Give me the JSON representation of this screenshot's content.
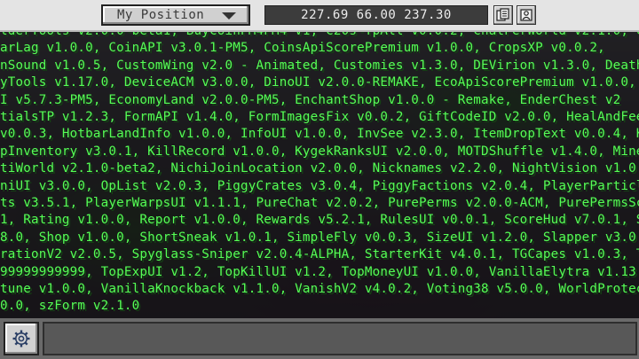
{
  "top_bar": {
    "position_dropdown": "My Position",
    "coordinates": "227.69 66.00 237.30"
  },
  "icons": {
    "copy": "copy-coordinates-icon",
    "export": "export-icon",
    "settings": "gear-icon"
  },
  "chat": {
    "text_color": "#55ff55",
    "lines": [
      "lderTools v2.0.0-beta1, BuyCoinPM4PM4 v1, C20s-TpAll v0.0.2, ChatPerWorld v2.1.0, C",
      "arLag v1.0.0, CoinAPI v3.0.1-PM5, CoinsApiScorePremium v1.0.0, CropsXP v0.0.2,",
      "nSound v1.0.5, CustomWing v2.0 - Animated, Customies v1.3.0, DEVirion v1.3.0, DeathPa",
      "yTools v1.17.0, DeviceACM v3.0.0, DinoUI v2.0.0-REMAKE, EcoApiScorePremium v1.0.0,",
      "I v5.7.3-PM5, EconomyLand v2.0.0-PM5, EnchantShop v1.0.0 - Remake, EnderChest v2",
      "tialsTP v1.2.3, FormAPI v1.4.0, FormImagesFix v0.0.2, GiftCodeID v2.0.0, HealAndFeed",
      "v0.0.3, HotbarLandInfo v1.0.0, InfoUI v1.0.0, InvSee v2.3.0, ItemDropText v0.0.4, Kee",
      "pInventory v3.0.1, KillRecord v1.0.0, KygekRanksUI v2.0.0, MOTDShuffle v1.4.0, MineRe",
      "tiWorld v2.1.0-beta2, NichiJoinLocation v2.0.0, Nicknames v2.2.0, NightVision v1.0.6, O",
      "niUI v3.0.0, OpList v2.0.3, PiggyCrates v3.0.4, PiggyFactions v2.0.4, PlayerParticleUI",
      "ts v3.5.1, PlayerWarpsUI v1.1.1, PureChat v2.0.2, PurePerms v2.0.0-ACM, PurePermsSc",
      "1, Rating v1.0.0, Report v1.0.0, Rewards v5.2.1, RulesUI v0.0.1, ScoreHud v7.0.1, SellAl",
      "8.0, Shop v1.0.0, ShortSneak v1.0.1, SimpleFly v0.0.3, SizeUI v1.2.0, Slapper v3.0.0,",
      "rationV2 v2.0.5, Spyglass-Sniper v2.0.4-ALPHA, StarterKit v4.0.1, TGCapes v1.0.3, Tim",
      "99999999999, TopExpUI v1.2, TopKillUI v1.2, TopMoneyUI v1.0.0, VanillaElytra v1.13.0,",
      "tune v1.0.0, VanillaKnockback v1.1.0, VanishV2 v4.0.2, Voting38 v5.0.0, WorldProtect v2",
      "0.0, szForm v2.1.0"
    ]
  },
  "chat_input": {
    "value": "",
    "placeholder": ""
  }
}
